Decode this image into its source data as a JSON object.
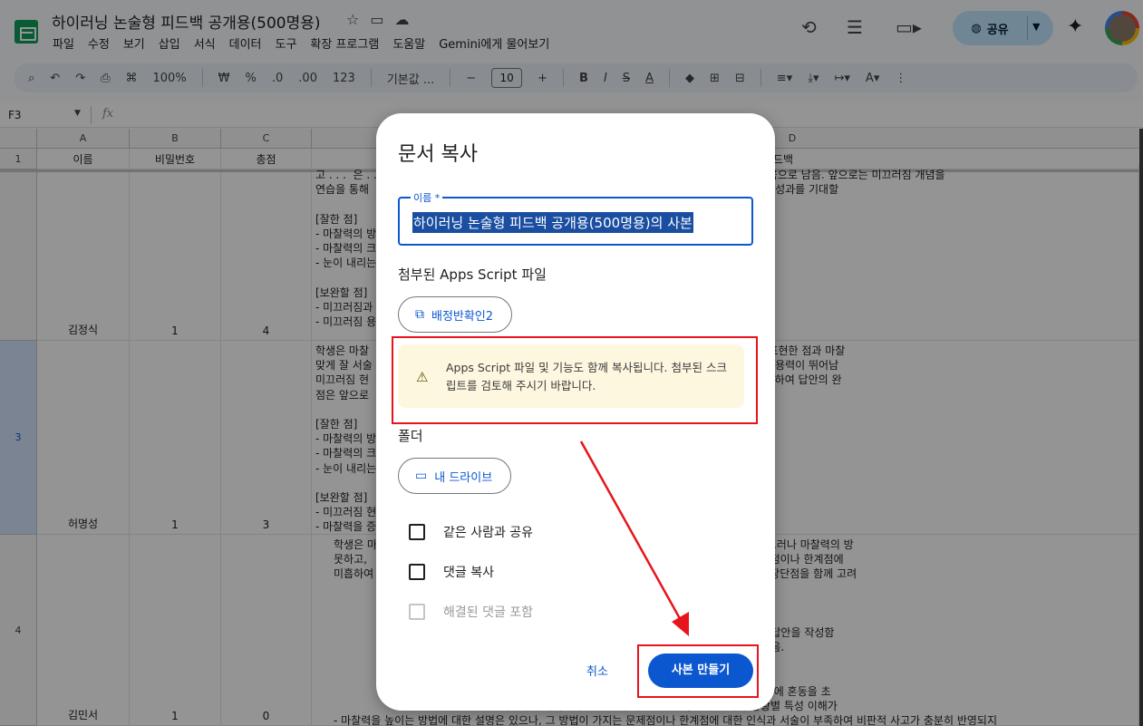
{
  "header": {
    "doc_title": "하이러닝 논술형 피드백 공개용(500명용)",
    "menu": [
      "파일",
      "수정",
      "보기",
      "삽입",
      "서식",
      "데이터",
      "도구",
      "확장 프로그램",
      "도움말",
      "Gemini에게 물어보기"
    ],
    "share_label": "공유"
  },
  "toolbar": {
    "zoom": "100%",
    "currency": "₩",
    "percent": "%",
    "dec_decrease": ".0",
    "dec_increase": ".00",
    "number_format": "123",
    "font": "기본값 ...",
    "font_size": "10",
    "bold": "B",
    "italic": "I",
    "strike": "S",
    "text_color": "A"
  },
  "formula_bar": {
    "cell_ref": "F3",
    "fx": "fx"
  },
  "grid": {
    "columns": [
      "A",
      "B",
      "C",
      "D"
    ],
    "headers": [
      "이름",
      "비밀번호",
      "총점",
      "피드백"
    ],
    "row_numbers": [
      "1",
      "3",
      "4"
    ],
    "rows": [
      {
        "name": "김정식",
        "password": "1",
        "score": "4",
        "feedback": "고 . . .  은 . .            갖추었음. 다                                       를 충분히 설명하지 못한 점은 아쉬움으로 남음. 앞으로는 미끄러짐 개념을\n연습을 통해                                       이 우수하므로, 부족한 부분을 보완한다면 더욱 훌륭한 학습 성과를 기대할\n\n[잘한 점]\n- 마찰력의 방                                      달한 점이 뛰어남.\n- 마찰력의 크                                      는 용어 활용 능력이 우수함.\n- 눈이 내리는                                      제시하여 실제 상황과 이론을 잘 연결한 점이 매우 훌륭함.\n\n[보완할 점]\n- 미끄러짐과                                      하는 부분에서 아쉬움이 남음.\n- 미끄러짐 용                                      함이 있어 보완이 필요함."
      },
      {
        "name": "허명성",
        "password": "1",
        "score": "3",
        "feedback": "학생은 마찰                                      갖추었으며, 특히 마찰력이 운동을 방해하는 힘임을 정확히 표현한 점과 마찰\n맞게 잘 서술                                      을 실제 사례와 연결하여 설명한 점에서 문제 해결 능력과 응용력이 뛰어남\n미끄러짐 현                                      가시키는 방법에 따른 부작용이나 문제점에 대한 고려가 부족하여 답안의 완\n점은 앞으로                                      을 작성할 수 있을 것으로 기대됨.\n\n[잘한 점]\n- 마찰력의 방                                      설명함으로써 기본 개념 이해도가 높음을 보여줌.\n- 마찰력의 크                                      남을 나타냄.\n- 눈이 내리는                                      써 문제 해결 능력과 응용력이 뛰어남.\n\n[보완할 점]\n- 미끄러짐 현                                      한 설명이 미흡함.\n- 마찰력을 증                                      하여 답안의 깊이가 다소 부족함."
      },
      {
        "name": "김민서",
        "password": "1",
        "score": "0",
        "feedback": "학생은 마                                        높이는 방법에 대해 언급하는 등 긍정적인 부분이 있음. 그러나 마찰력의 방\n못하고,                                        에 아쉬움이 있음. 또한, 마찰력을 높이는 방법에 따른 문제점이나 한계점에\n미흡하여                                        상황별 변화를 구체적으로 서술하며, 제시한 대안에 대한 장단점을 함께 고려\n                                                할 수 있을 것으로 기대됨.\n\n                                                잘한 점]\n                                                이는 방법에 대해 언급하는 등 기본적인 개념 이해에 기반한 답안을 작성함\n                                                느 정도 인식하고 있어 관련 주제에 대한 관심과 이해도가 있음.\n\n                                                완할 점]\n                                                동을 방해하는 힘임을 명확히 표현하지 못함으로써 개념 전달에 혼동을 초\n                                                마찰력이 작아진다는 점을 구체적으로 설명하지 못하여 상황별 특성 이해가\n- 마찰력을 높이는 방법에 대한 설명은 있으나, 그 방법이 가지는 문제점이나 한계점에 대한 인식과 서술이 부족하여 비판적 사고가 충분히 반영되지"
      }
    ]
  },
  "dialog": {
    "title": "문서 복사",
    "name_label": "이름 *",
    "name_value": "하이러닝 논술형 피드백 공개용(500명용)의 사본",
    "apps_script_label": "첨부된 Apps Script 파일",
    "script_chip": "배정반확인2",
    "warning": "Apps Script 파일 및 기능도 함께 복사됩니다. 첨부된 스크립트를 검토해 주시기 바랍니다.",
    "folder_label": "폴더",
    "folder_chip": "내 드라이브",
    "share_same": "같은 사람과 공유",
    "copy_comments": "댓글 복사",
    "include_resolved": "해결된 댓글 포함",
    "cancel": "취소",
    "create": "사본 만들기"
  },
  "colors": {
    "primary": "#0b57d0",
    "warning_bg": "#fef7e0",
    "annotation_red": "#e8141c",
    "sheets_green": "#0f9d58"
  }
}
